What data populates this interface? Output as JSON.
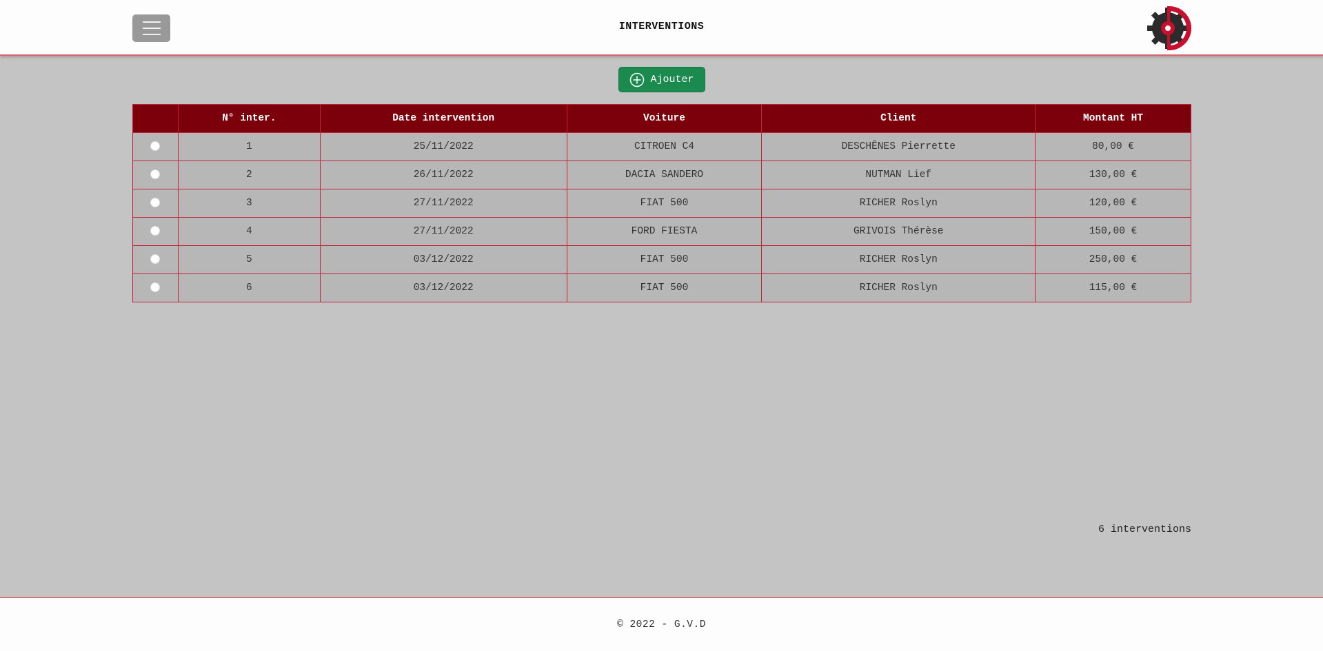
{
  "header": {
    "title": "INTERVENTIONS",
    "menu_icon": "hamburger-icon",
    "logo_icon": "gear-logo-icon",
    "colors": {
      "accent": "#7c000c",
      "logo_red": "#c8102e",
      "logo_dark": "#2b2b2b"
    }
  },
  "toolbar": {
    "add_label": "Ajouter",
    "add_icon": "plus-circle-icon",
    "add_color": "#1a8a4e"
  },
  "table": {
    "columns": [
      "",
      "N° inter.",
      "Date intervention",
      "Voiture",
      "Client",
      "Montant HT"
    ],
    "rows": [
      {
        "num": "1",
        "date": "25/11/2022",
        "car": "CITROEN C4",
        "client": "DESCHÊNES Pierrette",
        "amount": "80,00 €"
      },
      {
        "num": "2",
        "date": "26/11/2022",
        "car": "DACIA SANDERO",
        "client": "NUTMAN Lief",
        "amount": "130,00 €"
      },
      {
        "num": "3",
        "date": "27/11/2022",
        "car": "FIAT 500",
        "client": "RICHER Roslyn",
        "amount": "120,00 €"
      },
      {
        "num": "4",
        "date": "27/11/2022",
        "car": "FORD FIESTA",
        "client": "GRIVOIS Thérèse",
        "amount": "150,00 €"
      },
      {
        "num": "5",
        "date": "03/12/2022",
        "car": "FIAT 500",
        "client": "RICHER Roslyn",
        "amount": "250,00 €"
      },
      {
        "num": "6",
        "date": "03/12/2022",
        "car": "FIAT 500",
        "client": "RICHER Roslyn",
        "amount": "115,00 €"
      }
    ]
  },
  "summary": {
    "count_text": "6 interventions"
  },
  "footer": {
    "text": "© 2022 - G.V.D"
  }
}
